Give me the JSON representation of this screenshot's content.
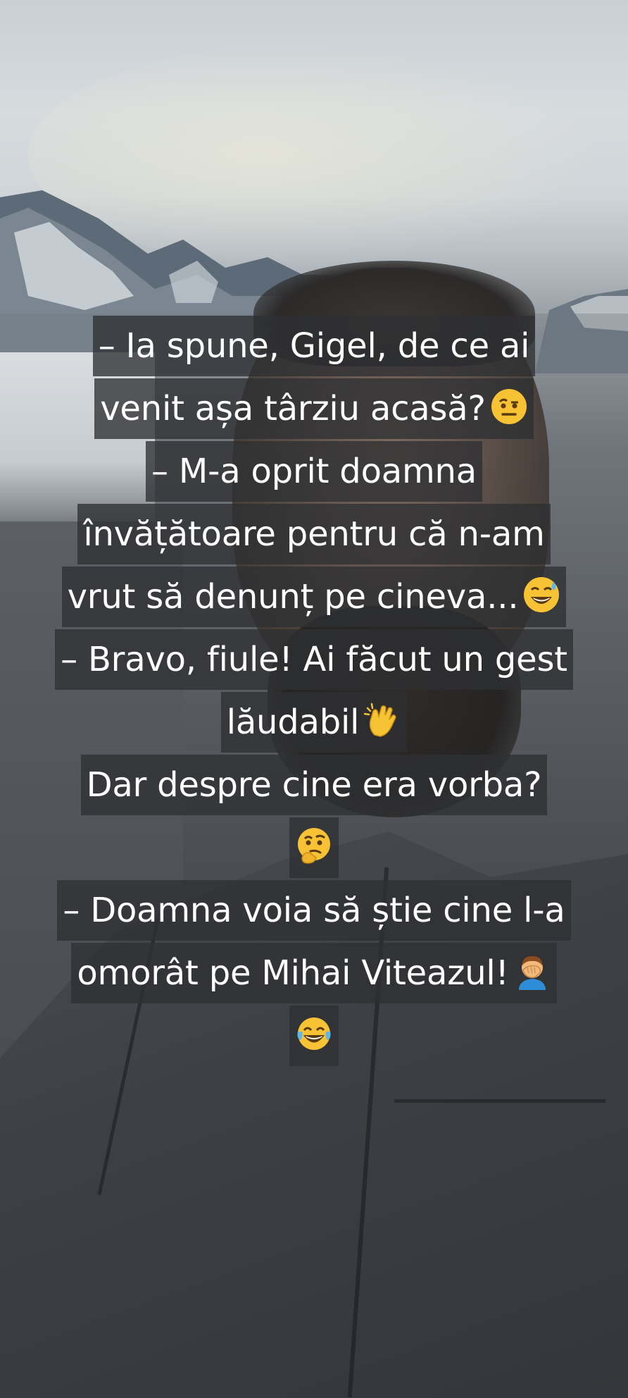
{
  "story": {
    "lines": [
      {
        "text": "– Ia spune, Gigel, de ce ai",
        "emoji": ""
      },
      {
        "text": "venit așa târziu acasă?",
        "emoji": "raised-eyebrow-face-icon"
      },
      {
        "text": "– M-a oprit doamna",
        "emoji": ""
      },
      {
        "text": "învățătoare pentru că n-am",
        "emoji": ""
      },
      {
        "text": "vrut să denunț pe cineva...",
        "emoji": "grinning-sweat-face-icon"
      },
      {
        "text": "– Bravo, fiule! Ai făcut un gest",
        "emoji": ""
      },
      {
        "text": "lăudabil",
        "emoji": "clapping-hands-icon"
      },
      {
        "text": "Dar despre cine era vorba?",
        "emoji": ""
      },
      {
        "text": "",
        "emoji": "thinking-face-icon"
      },
      {
        "text": "– Doamna voia să știe cine l-a",
        "emoji": ""
      },
      {
        "text": "omorât pe Mihai Viteazul!",
        "emoji": "facepalm-person-icon"
      },
      {
        "text": "",
        "emoji": "tears-of-joy-face-icon"
      }
    ]
  },
  "colors": {
    "text": "#ffffff",
    "highlight": "#2e3032",
    "emoji_yellow": "#f7c234"
  }
}
